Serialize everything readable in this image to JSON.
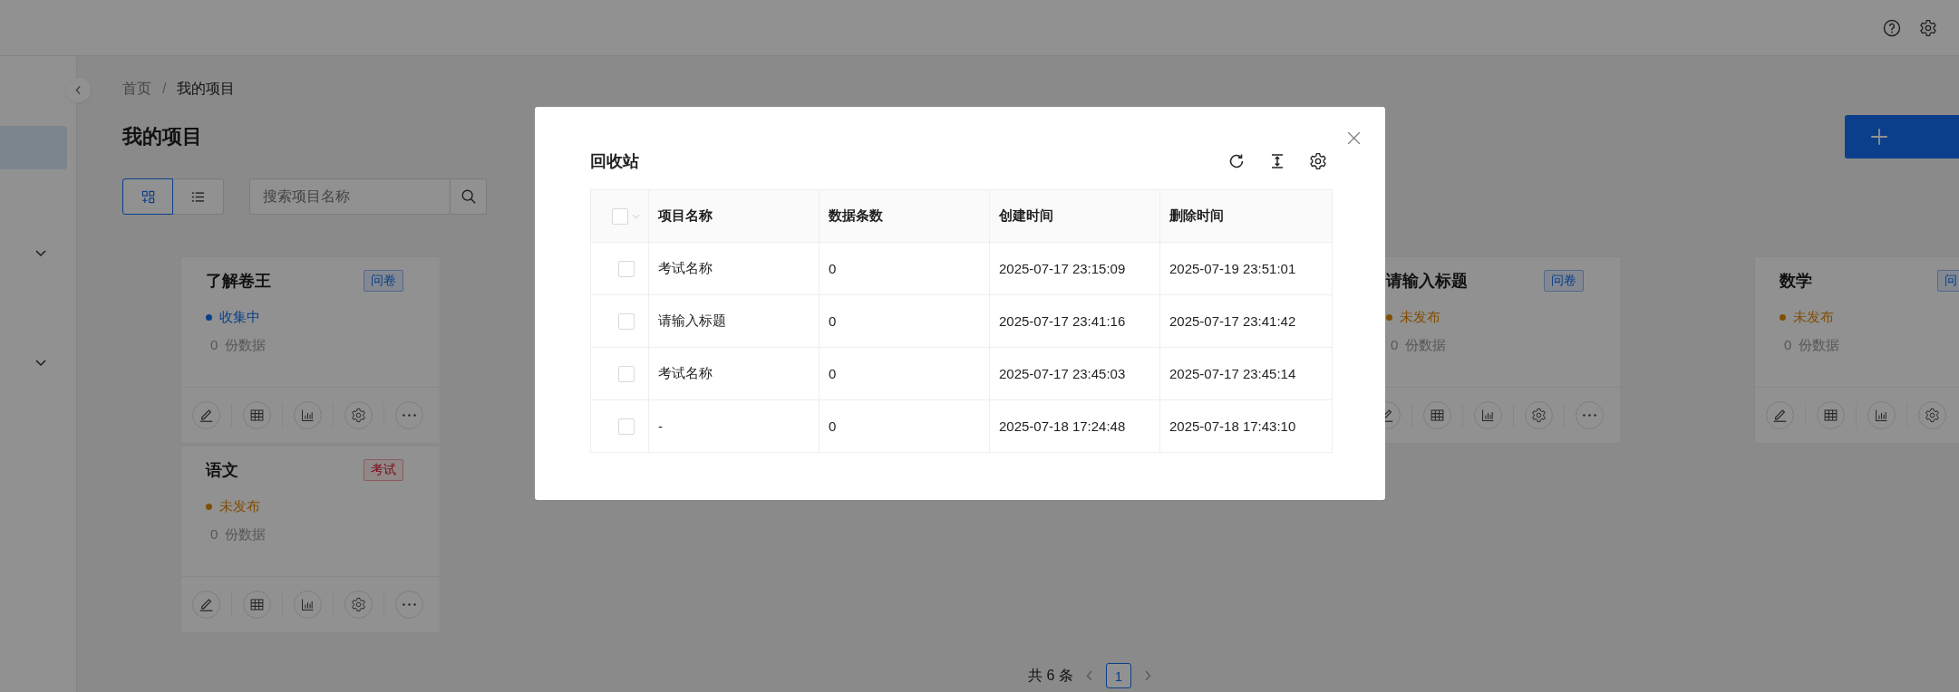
{
  "breadcrumb": [
    {
      "label": "首页",
      "current": false
    },
    {
      "label": "我的项目",
      "current": true
    }
  ],
  "breadcrumb_separator": "/",
  "page_title": "我的项目",
  "view_toggle": [
    {
      "kind": "grid",
      "selected": true
    },
    {
      "kind": "list",
      "selected": false
    }
  ],
  "search": {
    "placeholder": "搜索项目名称"
  },
  "projects": [
    {
      "title": "了解卷王",
      "tag": {
        "label": "问卷",
        "kind": "survey"
      },
      "status": {
        "label": "收集中",
        "kind": "collecting"
      },
      "count": "0",
      "count_label": "份数据",
      "actions": [
        {
          "kind": "edit"
        },
        {
          "kind": "table"
        },
        {
          "kind": "chart"
        },
        {
          "kind": "settings"
        },
        {
          "kind": "more"
        }
      ]
    },
    {
      "title": "请输入标题",
      "tag": {
        "label": "问卷",
        "kind": "survey"
      },
      "status": {
        "label": "未发布",
        "kind": "unpublished"
      },
      "count": "0",
      "count_label": "份数据",
      "actions": [
        {
          "kind": "edit"
        },
        {
          "kind": "table"
        },
        {
          "kind": "chart"
        },
        {
          "kind": "settings"
        },
        {
          "kind": "more"
        }
      ]
    },
    {
      "title": "数学",
      "tag": {
        "label": "问",
        "kind": "survey"
      },
      "status": {
        "label": "未发布",
        "kind": "unpublished"
      },
      "count": "0",
      "count_label": "份数据",
      "actions": [
        {
          "kind": "edit"
        },
        {
          "kind": "table"
        },
        {
          "kind": "chart"
        },
        {
          "kind": "settings"
        }
      ]
    },
    {
      "title": "语文",
      "tag": {
        "label": "考试",
        "kind": "exam"
      },
      "status": {
        "label": "未发布",
        "kind": "unpublished"
      },
      "count": "0",
      "count_label": "份数据",
      "actions": [
        {
          "kind": "edit"
        },
        {
          "kind": "table"
        },
        {
          "kind": "chart"
        },
        {
          "kind": "settings"
        },
        {
          "kind": "more"
        }
      ]
    }
  ],
  "pagination": {
    "total": "共 6 条",
    "pages": [
      {
        "label": "1",
        "selected": true
      }
    ]
  },
  "recycle_bin": {
    "title": "回收站",
    "select_all": {
      "checked": false
    },
    "columns": [
      "项目名称",
      "数据条数",
      "创建时间",
      "删除时间"
    ],
    "rows": [
      {
        "checked": false,
        "name": "考试名称",
        "count": "0",
        "created": "2025-07-17 23:15:09",
        "deleted": "2025-07-19 23:51:01"
      },
      {
        "checked": false,
        "name": "请输入标题",
        "count": "0",
        "created": "2025-07-17 23:41:16",
        "deleted": "2025-07-17 23:41:42"
      },
      {
        "checked": false,
        "name": "考试名称",
        "count": "0",
        "created": "2025-07-17 23:45:03",
        "deleted": "2025-07-17 23:45:14"
      },
      {
        "checked": false,
        "name": "-",
        "count": "0",
        "created": "2025-07-18 17:24:48",
        "deleted": "2025-07-18 17:43:10"
      }
    ]
  }
}
